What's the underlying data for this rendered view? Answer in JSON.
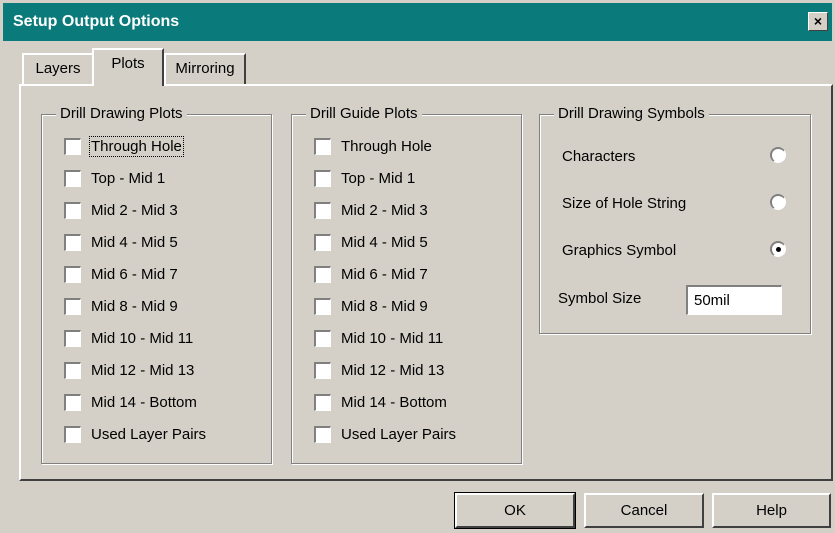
{
  "window": {
    "title": "Setup Output Options",
    "close_label": "×"
  },
  "tabs": [
    {
      "label": "Layers",
      "active": false
    },
    {
      "label": "Plots",
      "active": true
    },
    {
      "label": "Mirroring",
      "active": false
    }
  ],
  "drill_drawing_plots": {
    "title": "Drill Drawing Plots",
    "items": [
      "Through Hole",
      "Top - Mid 1",
      "Mid 2 - Mid 3",
      "Mid 4 - Mid 5",
      "Mid 6 - Mid 7",
      "Mid 8 - Mid 9",
      "Mid 10 - Mid 11",
      "Mid 12 - Mid 13",
      "Mid 14 - Bottom",
      "Used Layer Pairs"
    ]
  },
  "drill_guide_plots": {
    "title": "Drill Guide Plots",
    "items": [
      "Through Hole",
      "Top - Mid 1",
      "Mid 2 - Mid 3",
      "Mid 4 - Mid 5",
      "Mid 6 - Mid 7",
      "Mid 8 - Mid 9",
      "Mid 10 - Mid 11",
      "Mid 12 - Mid 13",
      "Mid 14 - Bottom",
      "Used Layer Pairs"
    ]
  },
  "drill_drawing_symbols": {
    "title": "Drill Drawing Symbols",
    "options": [
      {
        "label": "Characters",
        "selected": false
      },
      {
        "label": "Size of Hole String",
        "selected": false
      },
      {
        "label": "Graphics Symbol",
        "selected": true
      }
    ],
    "symbol_size_label": "Symbol Size",
    "symbol_size_value": "50mil"
  },
  "buttons": {
    "ok": "OK",
    "cancel": "Cancel",
    "help": "Help"
  }
}
